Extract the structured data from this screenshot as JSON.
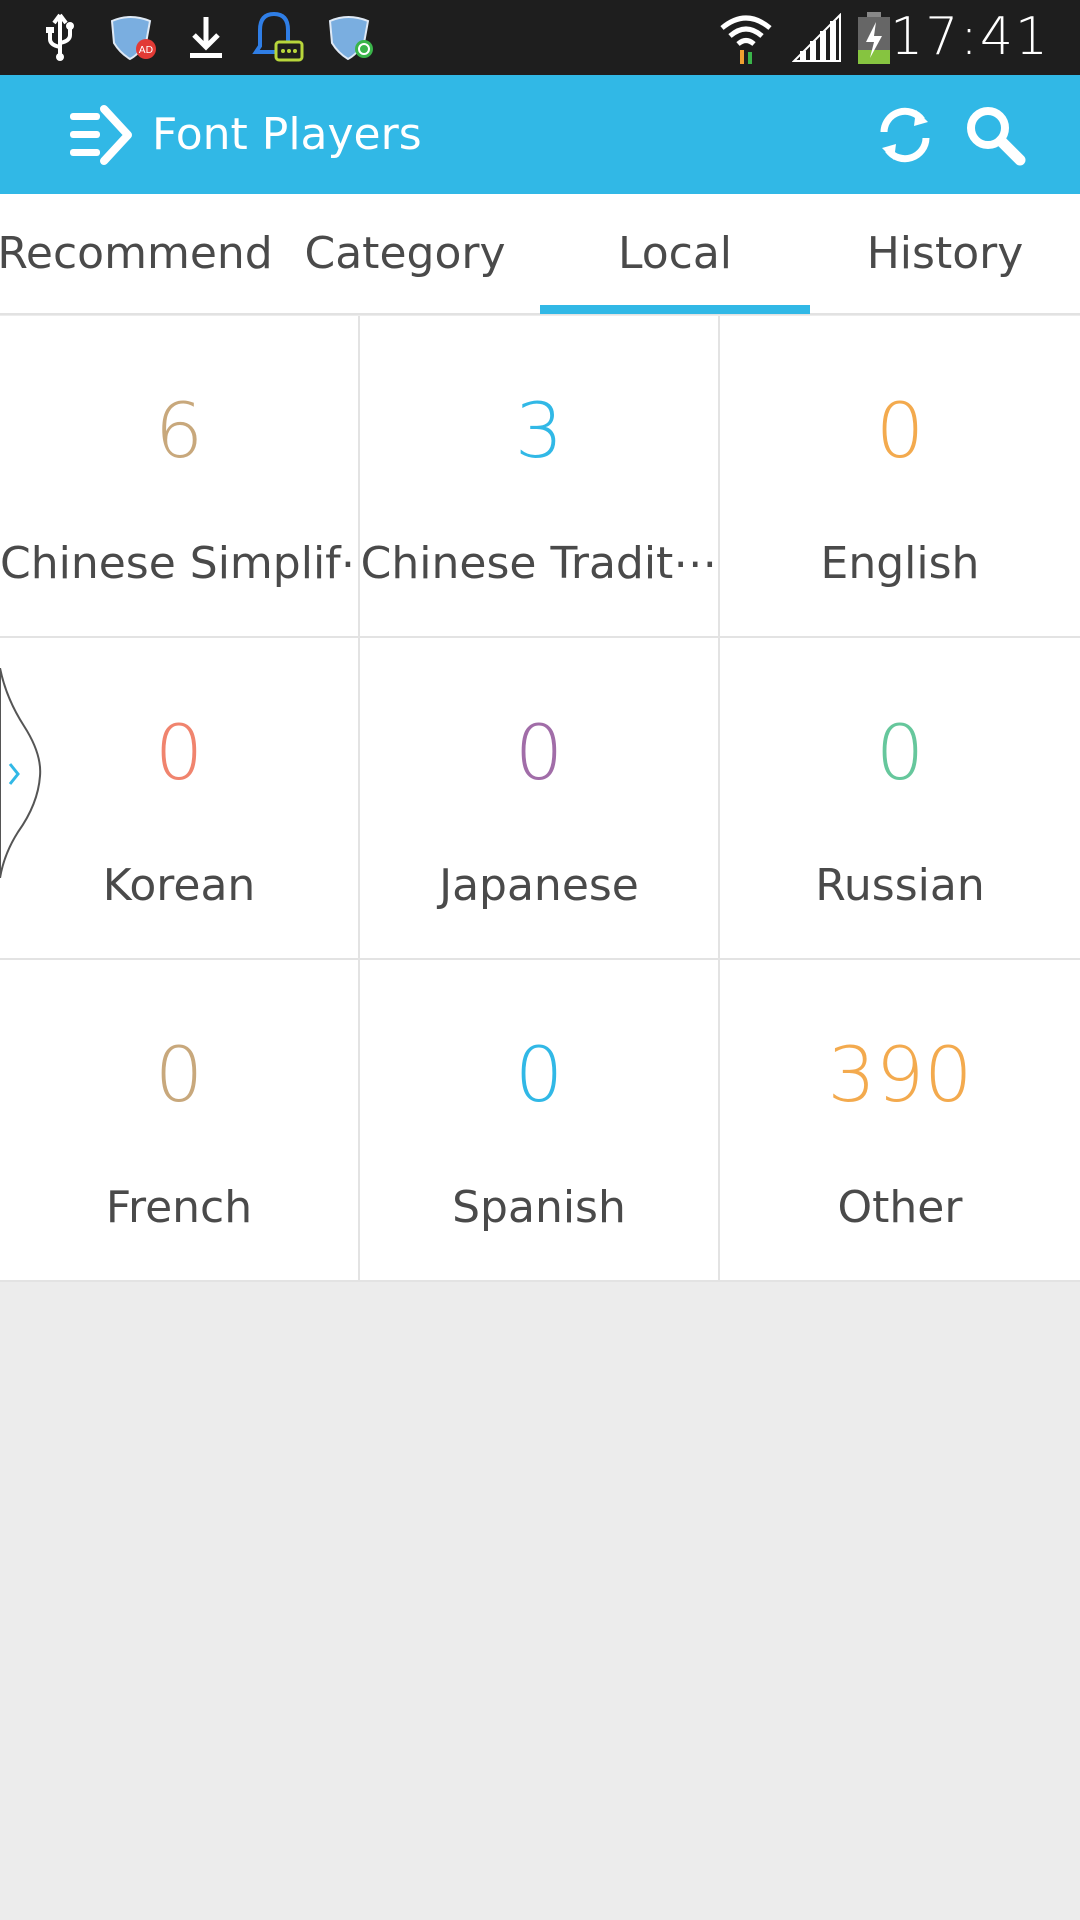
{
  "status_bar": {
    "time": "17:41",
    "icons": [
      "usb-icon",
      "ad-shield-icon",
      "download-icon",
      "chat-notification-icon",
      "vpn-shield-icon",
      "wifi-icon",
      "signal-icon",
      "battery-charging-icon"
    ]
  },
  "app_bar": {
    "title": "Font Players",
    "background": "#31b8e6",
    "icons": [
      "menu-arrow-icon",
      "refresh-icon",
      "search-icon"
    ]
  },
  "tabs": [
    {
      "label": "Recommend",
      "active": false
    },
    {
      "label": "Category",
      "active": false
    },
    {
      "label": "Local",
      "active": true
    },
    {
      "label": "History",
      "active": false
    }
  ],
  "languages": [
    {
      "count": "6",
      "label": "Chinese Simplif⋯",
      "color": "#c8a87c"
    },
    {
      "count": "3",
      "label": "Chinese Tradit⋯",
      "color": "#31b8e6"
    },
    {
      "count": "0",
      "label": "English",
      "color": "#f3aa4e"
    },
    {
      "count": "0",
      "label": "Korean",
      "color": "#f0846e"
    },
    {
      "count": "0",
      "label": "Japanese",
      "color": "#a16da8"
    },
    {
      "count": "0",
      "label": "Russian",
      "color": "#66c79c"
    },
    {
      "count": "0",
      "label": "French",
      "color": "#c8a87c"
    },
    {
      "count": "0",
      "label": "Spanish",
      "color": "#31b8e6"
    },
    {
      "count": "390",
      "label": "Other",
      "color": "#f3aa4e"
    }
  ]
}
